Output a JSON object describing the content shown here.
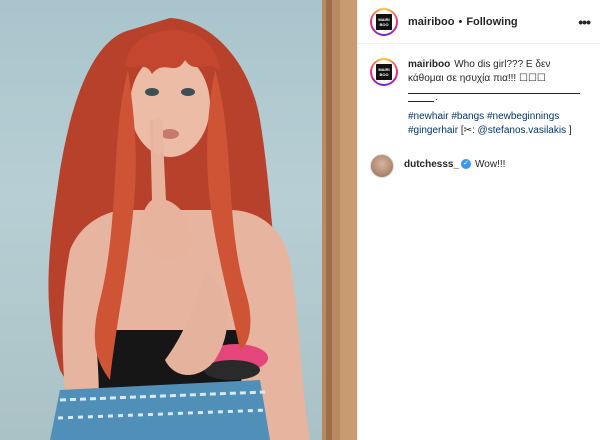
{
  "post": {
    "username": "mairiboo",
    "separator": "•",
    "follow_status": "Following",
    "logo_text": [
      "MAIRI",
      "BOO"
    ]
  },
  "caption": {
    "username": "mairiboo",
    "text": "Who dis girl??? Ε δεν κάθομαι σε ησυχία πια!!! ☐☐☐",
    "tags": [
      "#newhair",
      "#bangs",
      "#newbeginnings",
      "#gingerhair"
    ],
    "credit_prefix": "[✂:",
    "credit_user": "@stefanos.vasilakis",
    "credit_suffix": "]"
  },
  "comments": [
    {
      "username": "dutchesss_",
      "verified": true,
      "text": "Wow!!!"
    }
  ],
  "icons": {
    "more": "more-options-icon",
    "verified": "verified-badge-icon"
  },
  "colors": {
    "hair": "#c2412d",
    "link": "#00376b",
    "verified": "#3897f0"
  }
}
